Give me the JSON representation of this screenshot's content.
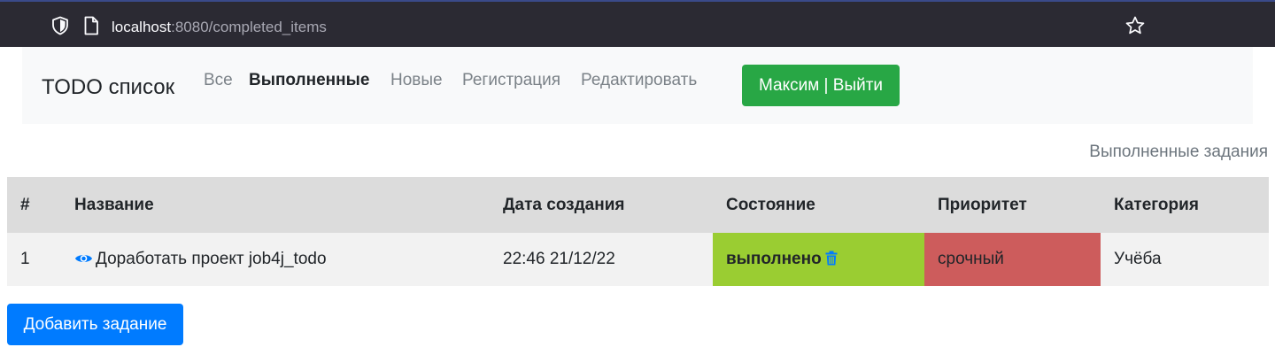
{
  "browser": {
    "url_host": "localhost",
    "url_path": ":8080/completed_items",
    "icons": [
      "shield-icon",
      "page-icon",
      "star-icon"
    ]
  },
  "navbar": {
    "brand": "TODO список",
    "links": [
      {
        "label": "Все",
        "active": false
      },
      {
        "label": "Выполненные",
        "active": true
      },
      {
        "label": "Новые",
        "active": false
      },
      {
        "label": "Регистрация",
        "active": false
      },
      {
        "label": "Редактировать",
        "active": false
      }
    ],
    "user_button": "Максим | Выйти"
  },
  "page": {
    "title": "Выполненные задания"
  },
  "table": {
    "headers": [
      "#",
      "Название",
      "Дата создания",
      "Состояние",
      "Приоритет",
      "Категория"
    ],
    "rows": [
      {
        "num": "1",
        "name": "Доработать проект job4j_todo",
        "created": "22:46 21/12/22",
        "state": "выполнено",
        "priority": "срочный",
        "category": "Учёба"
      }
    ]
  },
  "add_button": "Добавить задание",
  "colors": {
    "chrome_bg": "#2b2a33",
    "navbar_bg": "#f8f9fa",
    "user_button": "#28a745",
    "add_button": "#007bff",
    "state_done": "#9acd32",
    "priority_urgent": "#cd5c5c",
    "icon_blue": "#007bff"
  }
}
